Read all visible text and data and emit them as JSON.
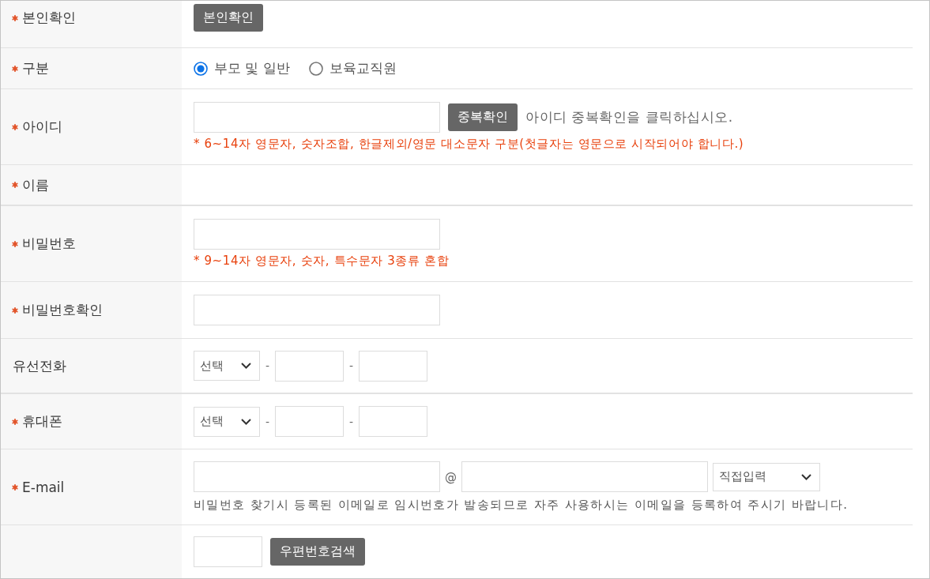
{
  "rows": [
    {
      "label": "본인확인",
      "required": true,
      "kind": "button",
      "button": "본인확인"
    },
    {
      "label": "구분",
      "required": true,
      "kind": "radio",
      "options": [
        {
          "label": "부모 및 일반",
          "selected": true
        },
        {
          "label": "보육교직원",
          "selected": false
        }
      ]
    },
    {
      "label": "아이디",
      "required": true,
      "kind": "id",
      "button": "중복확인",
      "note": "아이디 중복확인을 클릭하십시오.",
      "hint": "* 6~14자 영문자, 숫자조합, 한글제외/영문 대소문자 구분(첫글자는 영문으로 시작되어야 합니다.)"
    },
    {
      "label": "이름",
      "required": true,
      "kind": "empty"
    },
    {
      "label": "비밀번호",
      "required": true,
      "kind": "input",
      "hint": "* 9~14자 영문자, 숫자, 특수문자 3종류 혼합"
    },
    {
      "label": "비밀번호확인",
      "required": true,
      "kind": "input"
    },
    {
      "label": "유선전화",
      "required": false,
      "kind": "phone",
      "select": "선택",
      "separators": [
        "-",
        "-"
      ]
    },
    {
      "label": "휴대폰",
      "required": true,
      "kind": "phone",
      "select": "선택",
      "separators": [
        "-",
        "-"
      ]
    },
    {
      "label": "E-mail",
      "required": true,
      "kind": "email",
      "at": "@",
      "select": "직접입력",
      "note": "비밀번호 찾기시 등록된 이메일로 임시번호가 발송되므로 자주 사용하시는 이메일을 등록하여 주시기 바랍니다."
    },
    {
      "required": false,
      "kind": "address",
      "button": "우편번호검색"
    }
  ]
}
